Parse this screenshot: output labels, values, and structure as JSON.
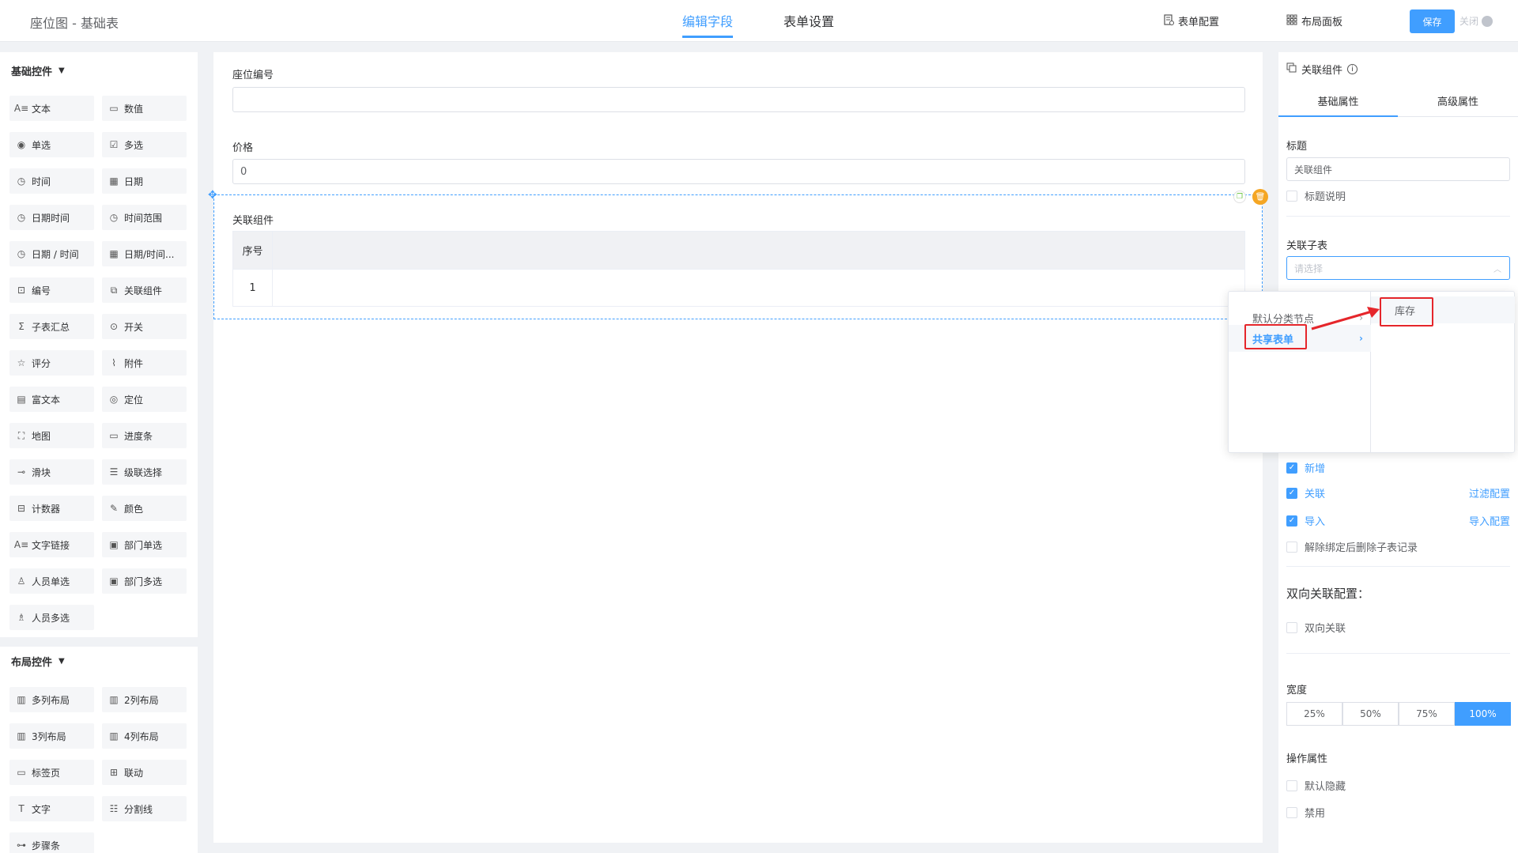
{
  "header": {
    "title": "座位图 - 基础表",
    "tabs": [
      "编辑字段",
      "表单设置"
    ],
    "form_config": "表单配置",
    "layout_panel": "布局面板",
    "save": "保存",
    "close": "关闭"
  },
  "left": {
    "basic_title": "基础控件",
    "basic_controls": [
      {
        "label": "文本",
        "icon": "text-icon"
      },
      {
        "label": "数值",
        "icon": "number-icon"
      },
      {
        "label": "单选",
        "icon": "radio-icon"
      },
      {
        "label": "多选",
        "icon": "checkbox-icon"
      },
      {
        "label": "时间",
        "icon": "clock-icon"
      },
      {
        "label": "日期",
        "icon": "calendar-icon"
      },
      {
        "label": "日期时间",
        "icon": "clock-icon"
      },
      {
        "label": "时间范围",
        "icon": "clock-icon"
      },
      {
        "label": "日期 / 时间",
        "icon": "clock-icon"
      },
      {
        "label": "日期/时间...",
        "icon": "calendar-icon"
      },
      {
        "label": "编号",
        "icon": "serial-icon"
      },
      {
        "label": "关联组件",
        "icon": "link-component-icon"
      },
      {
        "label": "子表汇总",
        "icon": "sigma-icon"
      },
      {
        "label": "开关",
        "icon": "toggle-icon"
      },
      {
        "label": "评分",
        "icon": "star-icon"
      },
      {
        "label": "附件",
        "icon": "paperclip-icon"
      },
      {
        "label": "富文本",
        "icon": "richtext-icon"
      },
      {
        "label": "定位",
        "icon": "location-icon"
      },
      {
        "label": "地图",
        "icon": "map-icon"
      },
      {
        "label": "进度条",
        "icon": "progress-icon"
      },
      {
        "label": "滑块",
        "icon": "slider-icon"
      },
      {
        "label": "级联选择",
        "icon": "cascade-icon"
      },
      {
        "label": "计数器",
        "icon": "counter-icon"
      },
      {
        "label": "颜色",
        "icon": "color-picker-icon"
      },
      {
        "label": "文字链接",
        "icon": "text-link-icon"
      },
      {
        "label": "部门单选",
        "icon": "department-icon"
      },
      {
        "label": "人员单选",
        "icon": "user-icon"
      },
      {
        "label": "部门多选",
        "icon": "department-icon"
      },
      {
        "label": "人员多选",
        "icon": "users-icon"
      }
    ],
    "layout_title": "布局控件",
    "layout_controls": [
      {
        "label": "多列布局",
        "icon": "columns-icon"
      },
      {
        "label": "2列布局",
        "icon": "columns-icon"
      },
      {
        "label": "3列布局",
        "icon": "columns-icon"
      },
      {
        "label": "4列布局",
        "icon": "columns-icon"
      },
      {
        "label": "标签页",
        "icon": "tabs-icon"
      },
      {
        "label": "联动",
        "icon": "grid-icon"
      },
      {
        "label": "文字",
        "icon": "text-t-icon"
      },
      {
        "label": "分割线",
        "icon": "divider-icon"
      },
      {
        "label": "步骤条",
        "icon": "steps-icon"
      }
    ]
  },
  "canvas": {
    "field1_label": "座位编号",
    "field1_value": "",
    "field2_label": "价格",
    "field2_value": "0",
    "related_label": "关联组件",
    "table_header": "序号",
    "table_row_index": "1"
  },
  "right": {
    "title": "关联组件",
    "tabs": [
      "基础属性",
      "高级属性"
    ],
    "title_label": "标题",
    "title_value": "关联组件",
    "title_desc": "标题说明",
    "sub_table_label": "关联子表",
    "sub_table_placeholder": "请选择",
    "checks": [
      {
        "label": "新增",
        "checked": true
      },
      {
        "label": "关联",
        "checked": true,
        "link": "过滤配置"
      },
      {
        "label": "导入",
        "checked": true,
        "link": "导入配置"
      },
      {
        "label": "解除绑定后删除子表记录",
        "checked": false
      }
    ],
    "bidirectional_title": "双向关联配置：",
    "bidirectional_check": "双向关联",
    "width_label": "宽度",
    "width_options": [
      "25%",
      "50%",
      "75%",
      "100%"
    ],
    "width_selected": "100%",
    "ops_label": "操作属性",
    "ops": [
      "默认隐藏",
      "禁用"
    ]
  },
  "cascader": {
    "column1": [
      "默认分类节点",
      "共享表单"
    ],
    "active": "共享表单",
    "column2": [
      "库存"
    ]
  },
  "colors": {
    "primary": "#409eff",
    "annotation": "#e5262b",
    "delete": "#f5a623"
  }
}
